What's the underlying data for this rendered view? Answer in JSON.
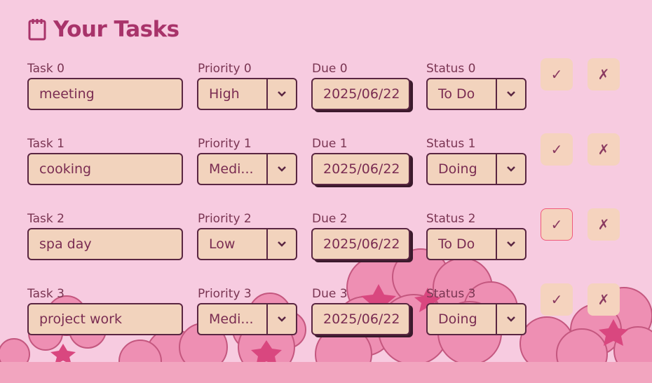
{
  "header": {
    "title": "Your Tasks",
    "icon": "notepad-icon"
  },
  "rows": [
    {
      "task_label": "Task 0",
      "task_value": "meeting",
      "priority_label": "Priority 0",
      "priority_value": "High",
      "due_label": "Due 0",
      "due_value": "2025/06/22",
      "status_label": "Status 0",
      "status_value": "To Do",
      "check_label": "✓",
      "x_label": "✗"
    },
    {
      "task_label": "Task 1",
      "task_value": "cooking",
      "priority_label": "Priority 1",
      "priority_value": "Medi...",
      "due_label": "Due 1",
      "due_value": "2025/06/22",
      "status_label": "Status 1",
      "status_value": "Doing",
      "check_label": "✓",
      "x_label": "✗"
    },
    {
      "task_label": "Task 2",
      "task_value": "spa day",
      "priority_label": "Priority 2",
      "priority_value": "Low",
      "due_label": "Due 2",
      "due_value": "2025/06/22",
      "status_label": "Status 2",
      "status_value": "To Do",
      "check_label": "✓",
      "x_label": "✗"
    },
    {
      "task_label": "Task 3",
      "task_value": "project work",
      "priority_label": "Priority 3",
      "priority_value": "Medi...",
      "due_label": "Due 3",
      "due_value": "2025/06/22",
      "status_label": "Status 3",
      "status_value": "Doing",
      "check_label": "✓",
      "x_label": "✗"
    }
  ],
  "colors": {
    "background": "#f7cbe0",
    "title": "#a8336a",
    "field_bg": "#f2d3bd",
    "border": "#5a2642",
    "active_outline": "#ef5a7a"
  }
}
